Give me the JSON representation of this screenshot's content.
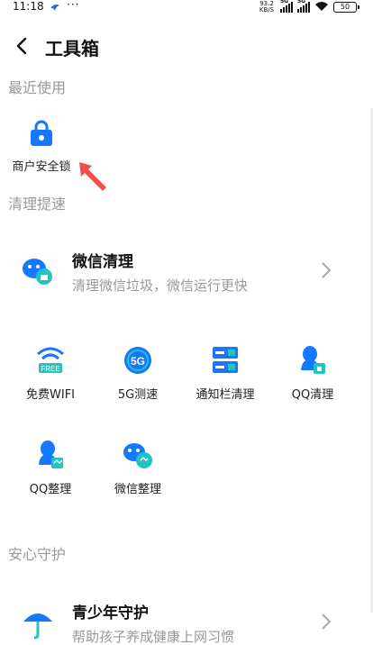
{
  "status_bar": {
    "time": "11:18",
    "dots": "···",
    "net_speed_value": "93.2",
    "net_speed_unit": "KB/S",
    "sim1": "5G",
    "sim2": "5G",
    "battery": "50"
  },
  "header": {
    "title": "工具箱"
  },
  "sections": {
    "recent": "最近使用",
    "clean": "清理提速",
    "guard": "安心守护"
  },
  "recent_items": [
    {
      "label": "商户安全锁",
      "icon": "lock-icon"
    }
  ],
  "wechat_clean": {
    "title": "微信清理",
    "desc": "清理微信垃圾，微信运行更快",
    "icon": "wechat-clean-icon"
  },
  "tools": [
    {
      "label": "免费WIFI",
      "icon": "free-wifi-icon"
    },
    {
      "label": "5G测速",
      "icon": "5g-speed-icon"
    },
    {
      "label": "通知栏清理",
      "icon": "notification-clean-icon"
    },
    {
      "label": "QQ清理",
      "icon": "qq-clean-icon"
    },
    {
      "label": "QQ整理",
      "icon": "qq-organize-icon"
    },
    {
      "label": "微信整理",
      "icon": "wechat-organize-icon"
    }
  ],
  "youth_guard": {
    "title": "青少年守护",
    "desc": "帮助孩子养成健康上网习惯",
    "icon": "umbrella-icon"
  },
  "icon_free_text": "FREE",
  "icon_5g_text": "5G",
  "colors": {
    "accent": "#1677ff",
    "teal": "#21c4c0",
    "arrow": "#f24c4c"
  }
}
